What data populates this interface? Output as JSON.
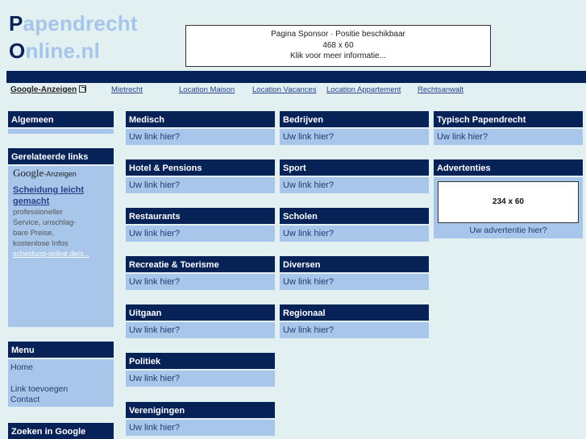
{
  "logo": {
    "line1_cap": "P",
    "line1_rest": "apendrecht",
    "line2_cap": "O",
    "line2_rest": "nline.nl"
  },
  "sponsor": {
    "line1": "Pagina Sponsor · Positie beschikbaar",
    "line2": "468 x 60",
    "line3": "Klik voor meer informatie..."
  },
  "top_links": {
    "google_label": "Google-Anzeigen",
    "items": [
      "Mietrecht",
      "Location Maison",
      "Location Vacances",
      "Location Appartement",
      "Rechtsanwalt"
    ]
  },
  "sidebar": {
    "algemeen": {
      "title": "Algemeen"
    },
    "gerelateerd": {
      "title": "Gerelateerde links",
      "google_logo": "Google",
      "google_suffix": "-Anzeigen",
      "ad": {
        "title_line1": "Scheidung leicht",
        "title_line2": "gemacht",
        "text": [
          "professioneller",
          "Service, unschlag-",
          "bare Preise,",
          "kostenlose Infos"
        ],
        "url": "scheidung-online.de/s..."
      }
    },
    "menu": {
      "title": "Menu",
      "items": [
        "Home",
        "Link toevoegen",
        "Contact"
      ]
    },
    "zoeken": {
      "title": "Zoeken in Google"
    }
  },
  "categories": {
    "link_text": "Uw link hier?",
    "col2": [
      "Medisch",
      "Hotel & Pensions",
      "Restaurants",
      "Recreatie & Toerisme",
      "Uitgaan",
      "Politiek",
      "Verenigingen"
    ],
    "col3": [
      "Bedrijven",
      "Sport",
      "Scholen",
      "Diversen",
      "Regionaal"
    ],
    "col4": [
      "Typisch Papendrecht"
    ]
  },
  "advertenties": {
    "title": "Advertenties",
    "banner": "234 x 60",
    "caption": "Uw advertentie hier?"
  }
}
